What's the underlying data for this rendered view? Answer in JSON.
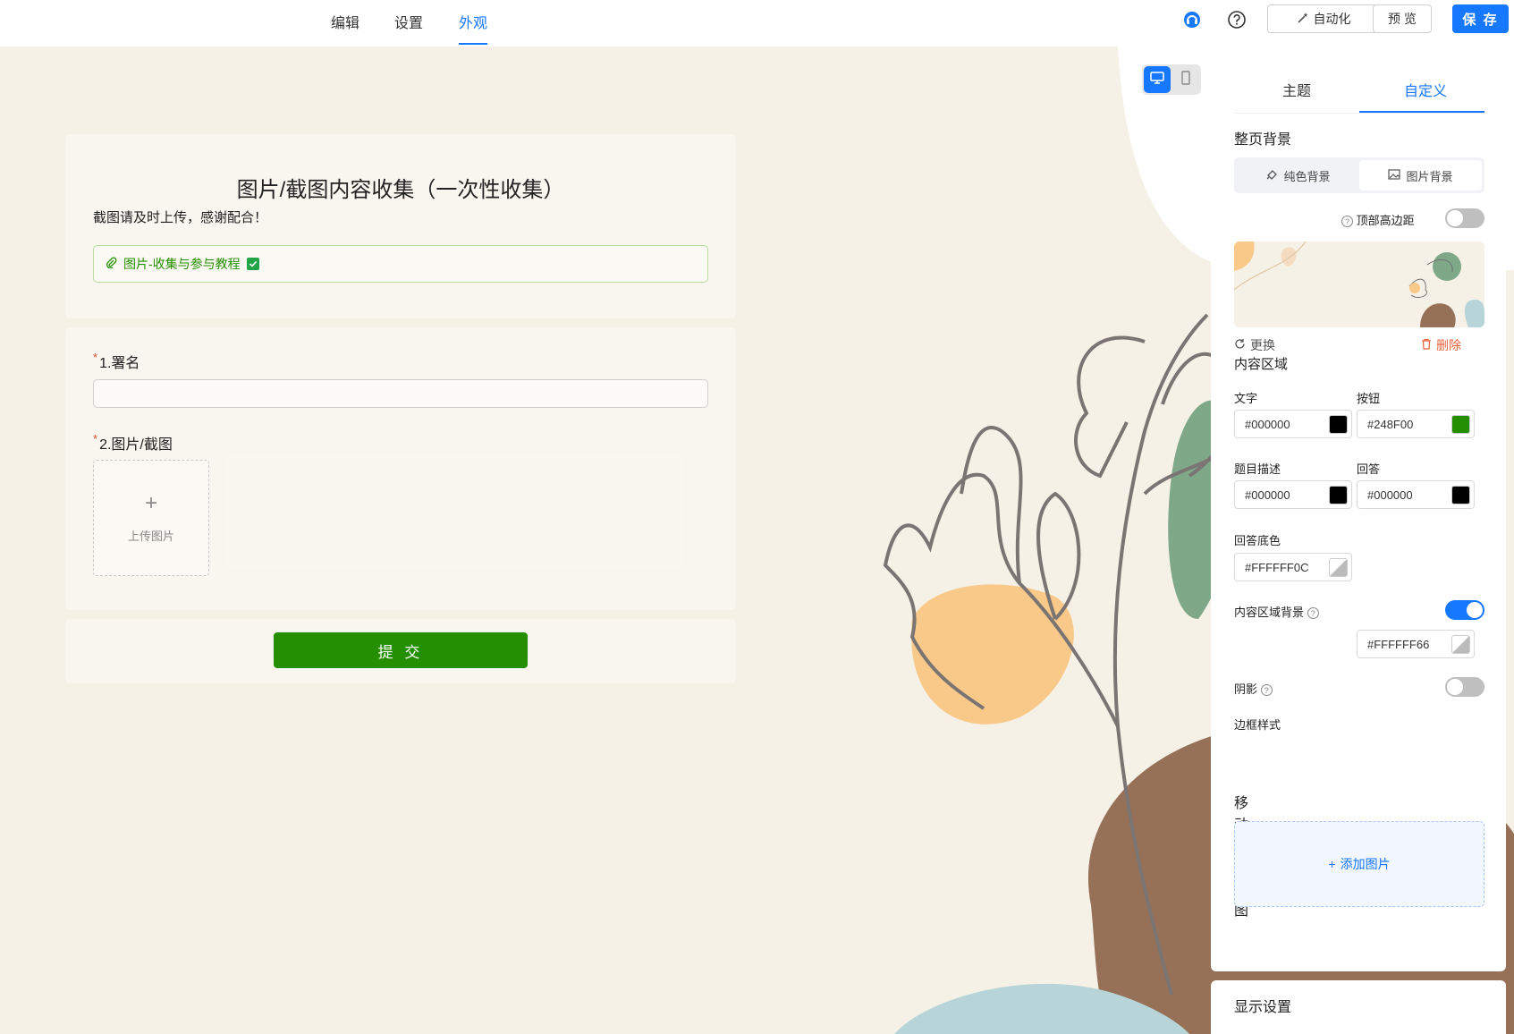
{
  "nav": {
    "tabs": [
      {
        "label": "编辑",
        "active": false
      },
      {
        "label": "设置",
        "active": false
      },
      {
        "label": "外观",
        "active": true
      }
    ],
    "automation_label": "自动化",
    "preview_label": "预 览",
    "save_label": "保 存",
    "accent_color": "#1677ff"
  },
  "form": {
    "title": "图片/截图内容收集（一次性收集）",
    "description": "截图请及时上传，感谢配合！",
    "attachment_label": "图片-收集与参与教程",
    "questions": [
      {
        "required_mark": "*",
        "label": "1.署名"
      },
      {
        "required_mark": "*",
        "label": "2.图片/截图",
        "upload_label": "上传图片"
      }
    ],
    "submit_label": "提 交",
    "button_color": "#248F00"
  },
  "panel": {
    "tabs": [
      {
        "label": "主题",
        "active": false
      },
      {
        "label": "自定义",
        "active": true
      }
    ],
    "page_bg": {
      "title": "整页背景",
      "options": [
        {
          "label": "纯色背景",
          "active": false
        },
        {
          "label": "图片背景",
          "active": true
        }
      ],
      "top_margin_label": "顶部高边距",
      "top_margin_on": false,
      "replace_label": "更换",
      "delete_label": "删除"
    },
    "content_area": {
      "title": "内容区域",
      "text": {
        "label": "文字",
        "value": "#000000"
      },
      "button": {
        "label": "按钮",
        "value": "#248F00"
      },
      "question_desc": {
        "label": "题目描述",
        "value": "#000000"
      },
      "answer": {
        "label": "回答",
        "value": "#000000"
      },
      "answer_bg": {
        "label": "回答底色",
        "value": "#FFFFFF0C"
      },
      "content_bg": {
        "label": "内容区域背景",
        "value": "#FFFFFF66",
        "on": true
      },
      "shadow": {
        "label": "阴影",
        "on": false
      },
      "border_style": {
        "label": "边框样式",
        "selected_index": 1
      }
    },
    "mobile_cover": {
      "title": "移动端封面图",
      "add_label": "添加图片"
    },
    "display_settings": {
      "title": "显示设置"
    }
  }
}
